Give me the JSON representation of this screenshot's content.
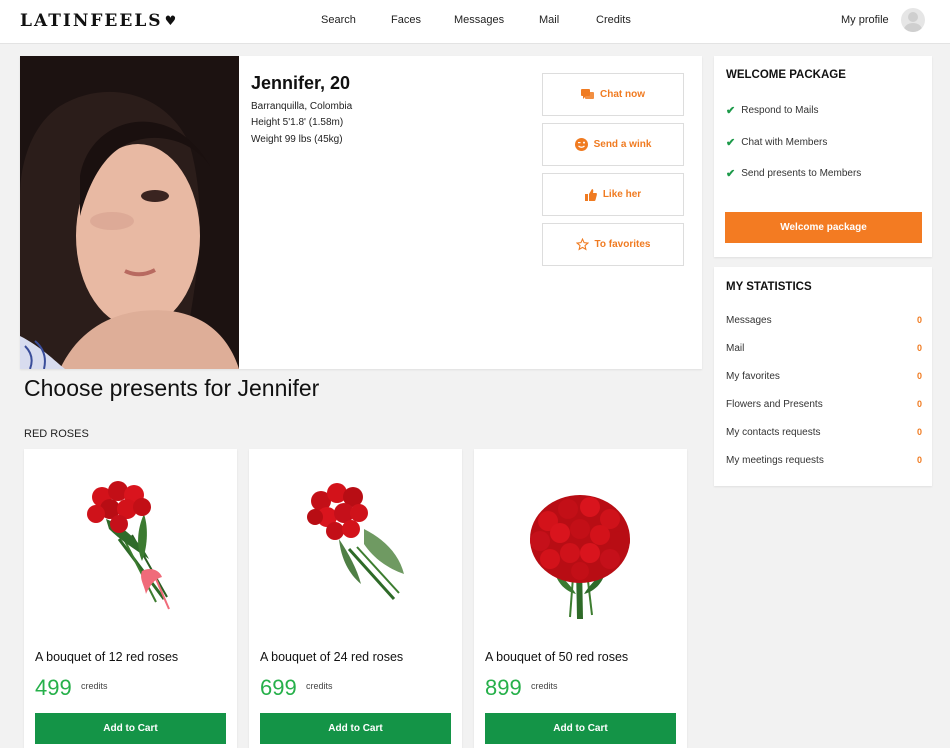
{
  "header": {
    "logo": "LATINFEELS",
    "nav": [
      "Search",
      "Faces",
      "Messages",
      "Mail",
      "Credits"
    ],
    "profile_label": "My profile"
  },
  "profile": {
    "name": "Jennifer, 20",
    "location": "Barranquilla, Colombia",
    "height": "Height 5'1.8' (1.58m)",
    "weight": "Weight 99 lbs (45kg)",
    "actions": [
      {
        "label": "Chat now",
        "icon": "chat-icon"
      },
      {
        "label": "Send a wink",
        "icon": "wink-icon"
      },
      {
        "label": "Like her",
        "icon": "thumbs-up-icon"
      },
      {
        "label": "To favorites",
        "icon": "star-icon"
      }
    ]
  },
  "welcome": {
    "title": "WELCOME PACKAGE",
    "items": [
      "Respond to Mails",
      "Chat with Members",
      "Send presents to Members"
    ],
    "button": "Welcome package"
  },
  "stats": {
    "title": "MY STATISTICS",
    "rows": [
      {
        "label": "Messages",
        "value": "0"
      },
      {
        "label": "Mail",
        "value": "0"
      },
      {
        "label": "My favorites",
        "value": "0"
      },
      {
        "label": "Flowers and Presents",
        "value": "0"
      },
      {
        "label": "My contacts requests",
        "value": "0"
      },
      {
        "label": "My meetings requests",
        "value": "0"
      }
    ]
  },
  "presents": {
    "title": "Choose presents for Jennifer",
    "section": "RED ROSES",
    "products": [
      {
        "name": "A bouquet of 12 red roses",
        "price": "499",
        "unit": "credits",
        "button": "Add to Cart"
      },
      {
        "name": "A bouquet of 24 red roses",
        "price": "699",
        "unit": "credits",
        "button": "Add to Cart"
      },
      {
        "name": "A bouquet of 50 red roses",
        "price": "899",
        "unit": "credits",
        "button": "Add to Cart"
      }
    ]
  },
  "colors": {
    "accent": "#f37b22",
    "cart": "#149447",
    "price": "#26b04a",
    "check": "#1d9a4a"
  }
}
